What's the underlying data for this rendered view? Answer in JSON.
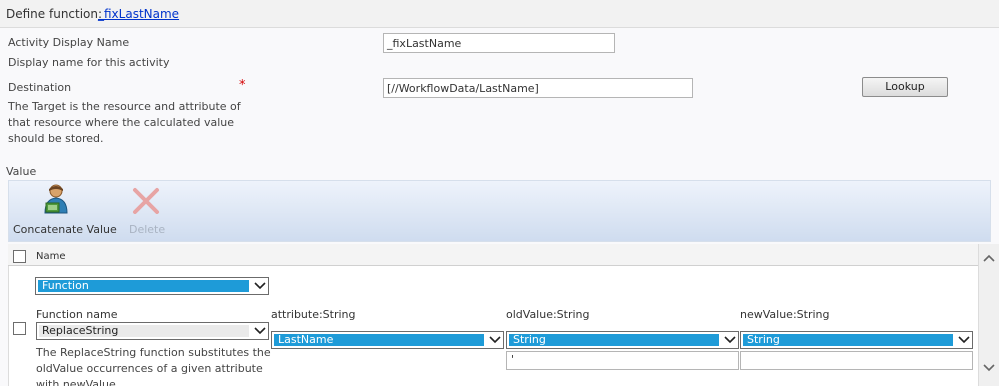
{
  "header": {
    "label": "Define function:",
    "function_link": "_fixLastName"
  },
  "activity_display_name": {
    "label": "Activity Display Name",
    "hint": "Display name for this activity",
    "value": "_fixLastName"
  },
  "destination": {
    "label": "Destination",
    "required_marker": "*",
    "hint_line1": "The Target is the resource and attribute of",
    "hint_line2": "that resource where the calculated value",
    "hint_line3": "should be stored.",
    "value": "[//WorkflowData/LastName]",
    "lookup_button": "Lookup"
  },
  "value_section": {
    "label": "Value"
  },
  "toolbar": {
    "concatenate_label": "Concatenate Value",
    "delete_label": "Delete"
  },
  "grid": {
    "name_header": "Name",
    "type_select": "Function",
    "function_name_label": "Function name",
    "function_name_select": "ReplaceString",
    "description_line1": "The ReplaceString function substitutes the",
    "description_line2": "oldValue occurrences of a given attribute",
    "description_line3": "with newValue.",
    "params": [
      {
        "label": "attribute:String",
        "select": "LastName",
        "input": ""
      },
      {
        "label": "oldValue:String",
        "select": "String",
        "input": "'"
      },
      {
        "label": "newValue:String",
        "select": "String",
        "input": ""
      }
    ]
  },
  "colors": {
    "accent": "#1e9bd8",
    "link": "#0033cc",
    "required": "#d40000"
  },
  "icons": [
    "user-add-icon",
    "delete-x-icon",
    "chevron-down-icon",
    "scroll-up-icon",
    "scroll-down-icon"
  ]
}
